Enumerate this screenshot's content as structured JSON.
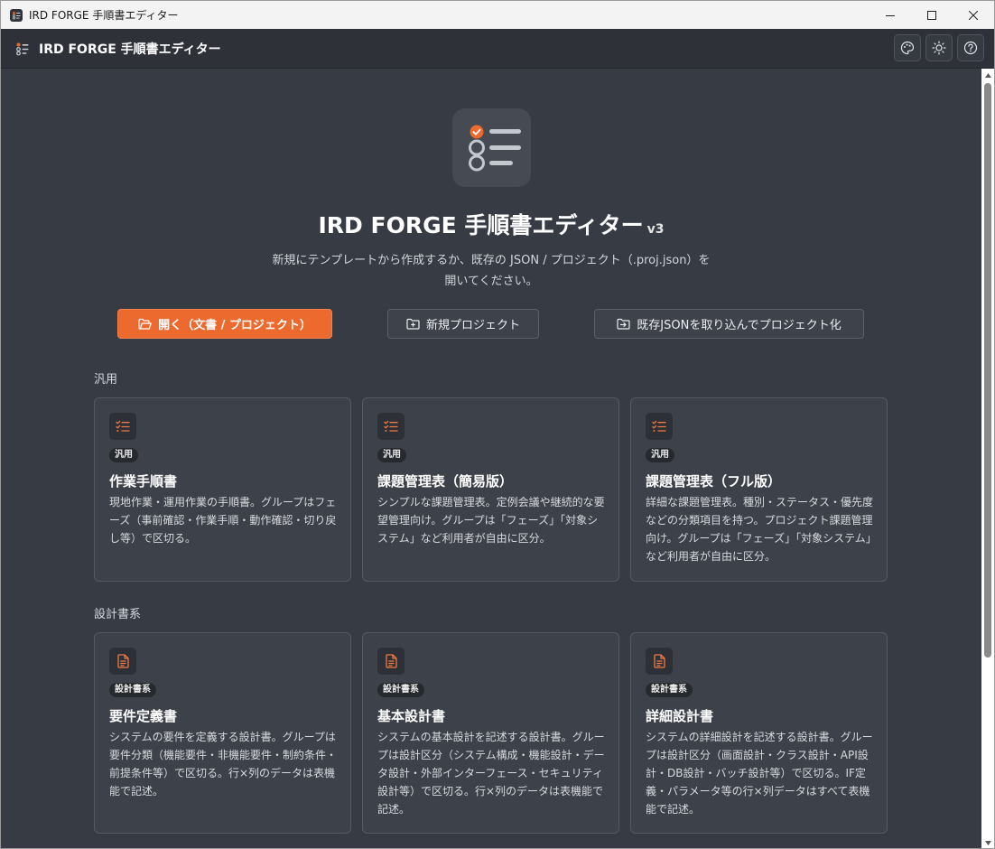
{
  "window": {
    "title": "IRD FORGE 手順書エディター"
  },
  "header": {
    "title": "IRD FORGE 手順書エディター"
  },
  "hero": {
    "title": "IRD FORGE 手順書エディター",
    "version": "v3",
    "subtitle_line1": "新規にテンプレートから作成するか、既存の JSON / プロジェクト（.proj.json）を",
    "subtitle_line2": "開いてください。"
  },
  "actions": {
    "open_label": "開く（文書 / プロジェクト）",
    "new_label": "新規プロジェクト",
    "import_label": "既存JSONを取り込んでプロジェクト化"
  },
  "sections": [
    {
      "label": "汎用",
      "cards": [
        {
          "tag": "汎用",
          "title": "作業手順書",
          "icon": "checklist-icon",
          "desc": "現地作業・運用作業の手順書。グループはフェーズ（事前確認・作業手順・動作確認・切り戻し等）で区切る。"
        },
        {
          "tag": "汎用",
          "title": "課題管理表（簡易版）",
          "icon": "checklist-icon",
          "desc": "シンプルな課題管理表。定例会議や継続的な要望管理向け。グループは「フェーズ」「対象システム」など利用者が自由に区分。"
        },
        {
          "tag": "汎用",
          "title": "課題管理表（フル版）",
          "icon": "checklist-icon",
          "desc": "詳細な課題管理表。種別・ステータス・優先度などの分類項目を持つ。プロジェクト課題管理向け。グループは「フェーズ」「対象システム」など利用者が自由に区分。"
        }
      ]
    },
    {
      "label": "設計書系",
      "cards": [
        {
          "tag": "設計書系",
          "title": "要件定義書",
          "icon": "document-icon",
          "desc": "システムの要件を定義する設計書。グループは要件分類（機能要件・非機能要件・制約条件・前提条件等）で区切る。行×列のデータは表機能で記述。"
        },
        {
          "tag": "設計書系",
          "title": "基本設計書",
          "icon": "document-icon",
          "desc": "システムの基本設計を記述する設計書。グループは設計区分（システム構成・機能設計・データ設計・外部インターフェース・セキュリティ設計等）で区切る。行×列のデータは表機能で記述。"
        },
        {
          "tag": "設計書系",
          "title": "詳細設計書",
          "icon": "document-icon",
          "desc": "システムの詳細設計を記述する設計書。グループは設計区分（画面設計・クラス設計・API設計・DB設計・バッチ設計等）で区切る。IF定義・パラメータ等の行×列データはすべて表機能で記述。"
        }
      ]
    }
  ],
  "colors": {
    "accent": "#ed6a2f",
    "background": "#373b43",
    "card": "#3d4149"
  }
}
